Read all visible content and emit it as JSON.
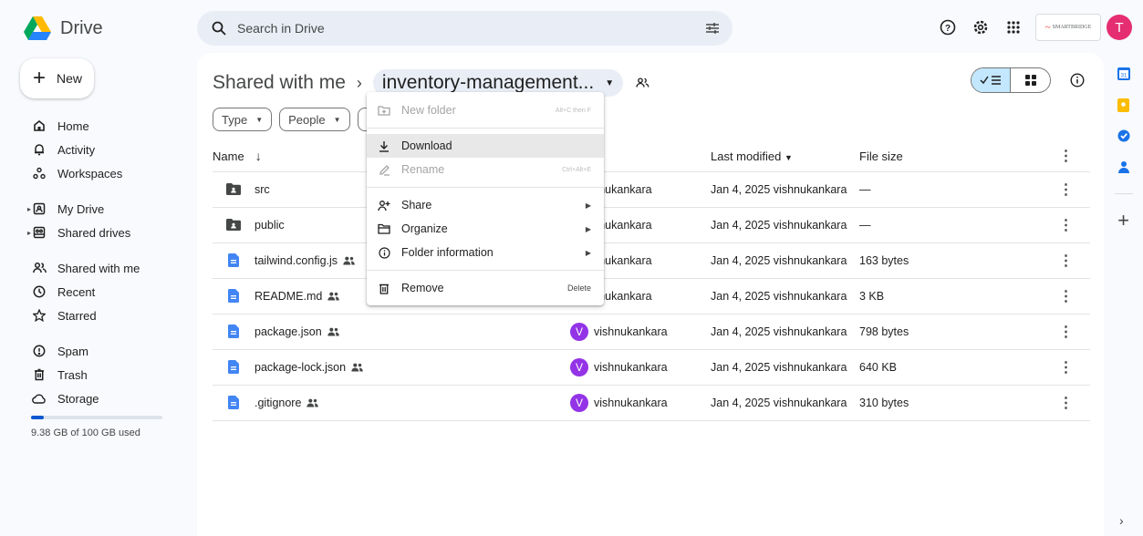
{
  "app": {
    "name": "Drive"
  },
  "search": {
    "placeholder": "Search in Drive"
  },
  "header": {
    "org_label": "SMARTBRIDGE",
    "avatar_letter": "T"
  },
  "new_button": {
    "label": "New"
  },
  "sidebar": {
    "items": [
      {
        "label": "Home",
        "icon": "home-icon"
      },
      {
        "label": "Activity",
        "icon": "bell-icon"
      },
      {
        "label": "Workspaces",
        "icon": "workspaces-icon"
      },
      {
        "label": "My Drive",
        "icon": "my-drive-icon"
      },
      {
        "label": "Shared drives",
        "icon": "shared-drives-icon"
      },
      {
        "label": "Shared with me",
        "icon": "people-icon"
      },
      {
        "label": "Recent",
        "icon": "clock-icon"
      },
      {
        "label": "Starred",
        "icon": "star-icon"
      },
      {
        "label": "Spam",
        "icon": "spam-icon"
      },
      {
        "label": "Trash",
        "icon": "trash-icon"
      },
      {
        "label": "Storage",
        "icon": "cloud-icon"
      }
    ],
    "storage_text": "9.38 GB of 100 GB used",
    "storage_fraction": 0.0938
  },
  "breadcrumb": {
    "parent": "Shared with me",
    "current": "inventory-management..."
  },
  "filters": {
    "type": "Type",
    "people": "People"
  },
  "table": {
    "headers": {
      "name": "Name",
      "last_modified": "Last modified",
      "file_size": "File size"
    },
    "rows": [
      {
        "name": "src",
        "kind": "folder",
        "shared": false,
        "owner": "vishnukankara",
        "modified": "Jan 4, 2025 vishnukankara",
        "size": "—"
      },
      {
        "name": "public",
        "kind": "folder",
        "shared": false,
        "owner": "vishnukankara",
        "modified": "Jan 4, 2025 vishnukankara",
        "size": "—"
      },
      {
        "name": "tailwind.config.js",
        "kind": "file",
        "shared": true,
        "owner": "vishnukankara",
        "modified": "Jan 4, 2025 vishnukankara",
        "size": "163 bytes"
      },
      {
        "name": "README.md",
        "kind": "file",
        "shared": true,
        "owner": "vishnukankara",
        "modified": "Jan 4, 2025 vishnukankara",
        "size": "3 KB"
      },
      {
        "name": "package.json",
        "kind": "file",
        "shared": true,
        "owner": "vishnukankara",
        "owner_initial": "V",
        "modified": "Jan 4, 2025 vishnukankara",
        "size": "798 bytes"
      },
      {
        "name": "package-lock.json",
        "kind": "file",
        "shared": true,
        "owner": "vishnukankara",
        "owner_initial": "V",
        "modified": "Jan 4, 2025 vishnukankara",
        "size": "640 KB"
      },
      {
        "name": ".gitignore",
        "kind": "file",
        "shared": true,
        "owner": "vishnukankara",
        "owner_initial": "V",
        "modified": "Jan 4, 2025 vishnukankara",
        "size": "310 bytes"
      }
    ]
  },
  "context_menu": {
    "new_folder": {
      "label": "New folder",
      "shortcut": "Alt+C then F"
    },
    "download": {
      "label": "Download"
    },
    "rename": {
      "label": "Rename",
      "shortcut": "Ctrl+Alt+E"
    },
    "share": {
      "label": "Share"
    },
    "organize": {
      "label": "Organize"
    },
    "folder_info": {
      "label": "Folder information"
    },
    "remove": {
      "label": "Remove",
      "shortcut": "Delete"
    }
  },
  "colors": {
    "accent": "#0b57d0",
    "avatar": "#e52e71",
    "owner_avatar": "#9334e6"
  }
}
